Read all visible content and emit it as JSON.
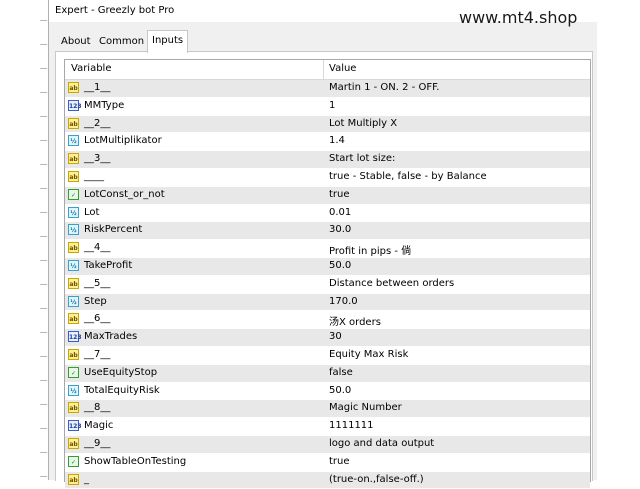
{
  "window": {
    "title": "Expert - Greezly bot Pro"
  },
  "watermark": "www.mt4.shop",
  "tabs": [
    {
      "label": "About",
      "active": false
    },
    {
      "label": "Common",
      "active": false
    },
    {
      "label": "Inputs",
      "active": true
    }
  ],
  "table": {
    "headers": {
      "variable": "Variable",
      "value": "Value"
    },
    "rows": [
      {
        "type": "string",
        "icon": "ab",
        "variable": "__1__",
        "value": "Martin 1 - ON. 2 - OFF."
      },
      {
        "type": "int",
        "icon": "123",
        "variable": "MMType",
        "value": "1"
      },
      {
        "type": "string",
        "icon": "ab",
        "variable": "__2__",
        "value": "Lot Multiply X"
      },
      {
        "type": "double",
        "icon": "1/2",
        "variable": "LotMultiplikator",
        "value": "1.4"
      },
      {
        "type": "string",
        "icon": "ab",
        "variable": "__3__",
        "value": "Start lot size:"
      },
      {
        "type": "string",
        "icon": "ab",
        "variable": "____",
        "value": "true - Stable, false - by Balance"
      },
      {
        "type": "bool",
        "icon": "bool-icon",
        "variable": "LotConst_or_not",
        "value": "true"
      },
      {
        "type": "double",
        "icon": "1/2",
        "variable": "Lot",
        "value": "0.01"
      },
      {
        "type": "double",
        "icon": "1/2",
        "variable": "RiskPercent",
        "value": "30.0"
      },
      {
        "type": "string",
        "icon": "ab",
        "variable": "__4__",
        "value": "Profit in pips - 倘"
      },
      {
        "type": "double",
        "icon": "1/2",
        "variable": "TakeProfit",
        "value": "50.0"
      },
      {
        "type": "string",
        "icon": "ab",
        "variable": "__5__",
        "value": "Distance between orders"
      },
      {
        "type": "double",
        "icon": "1/2",
        "variable": "Step",
        "value": "170.0"
      },
      {
        "type": "string",
        "icon": "ab",
        "variable": "__6__",
        "value": "汤X orders"
      },
      {
        "type": "int",
        "icon": "123",
        "variable": "MaxTrades",
        "value": "30"
      },
      {
        "type": "string",
        "icon": "ab",
        "variable": "__7__",
        "value": "Equity Max Risk"
      },
      {
        "type": "bool",
        "icon": "bool-icon",
        "variable": "UseEquityStop",
        "value": "false"
      },
      {
        "type": "double",
        "icon": "1/2",
        "variable": "TotalEquityRisk",
        "value": "50.0"
      },
      {
        "type": "string",
        "icon": "ab",
        "variable": "__8__",
        "value": "Magic Number"
      },
      {
        "type": "int",
        "icon": "123",
        "variable": "Magic",
        "value": "1111111"
      },
      {
        "type": "string",
        "icon": "ab",
        "variable": "__9__",
        "value": "logo and data output"
      },
      {
        "type": "bool",
        "icon": "bool-icon",
        "variable": "ShowTableOnTesting",
        "value": "true"
      },
      {
        "type": "string",
        "icon": "ab",
        "variable": "_",
        "value": "(true-on.,false-off.)"
      }
    ]
  },
  "colors": {
    "row_shade": "#e8e8e8",
    "string_icon": "#ffef90",
    "int_icon": "#e8f0ff",
    "double_icon": "#e0f6ff",
    "bool_icon": "#e6f8e6"
  }
}
